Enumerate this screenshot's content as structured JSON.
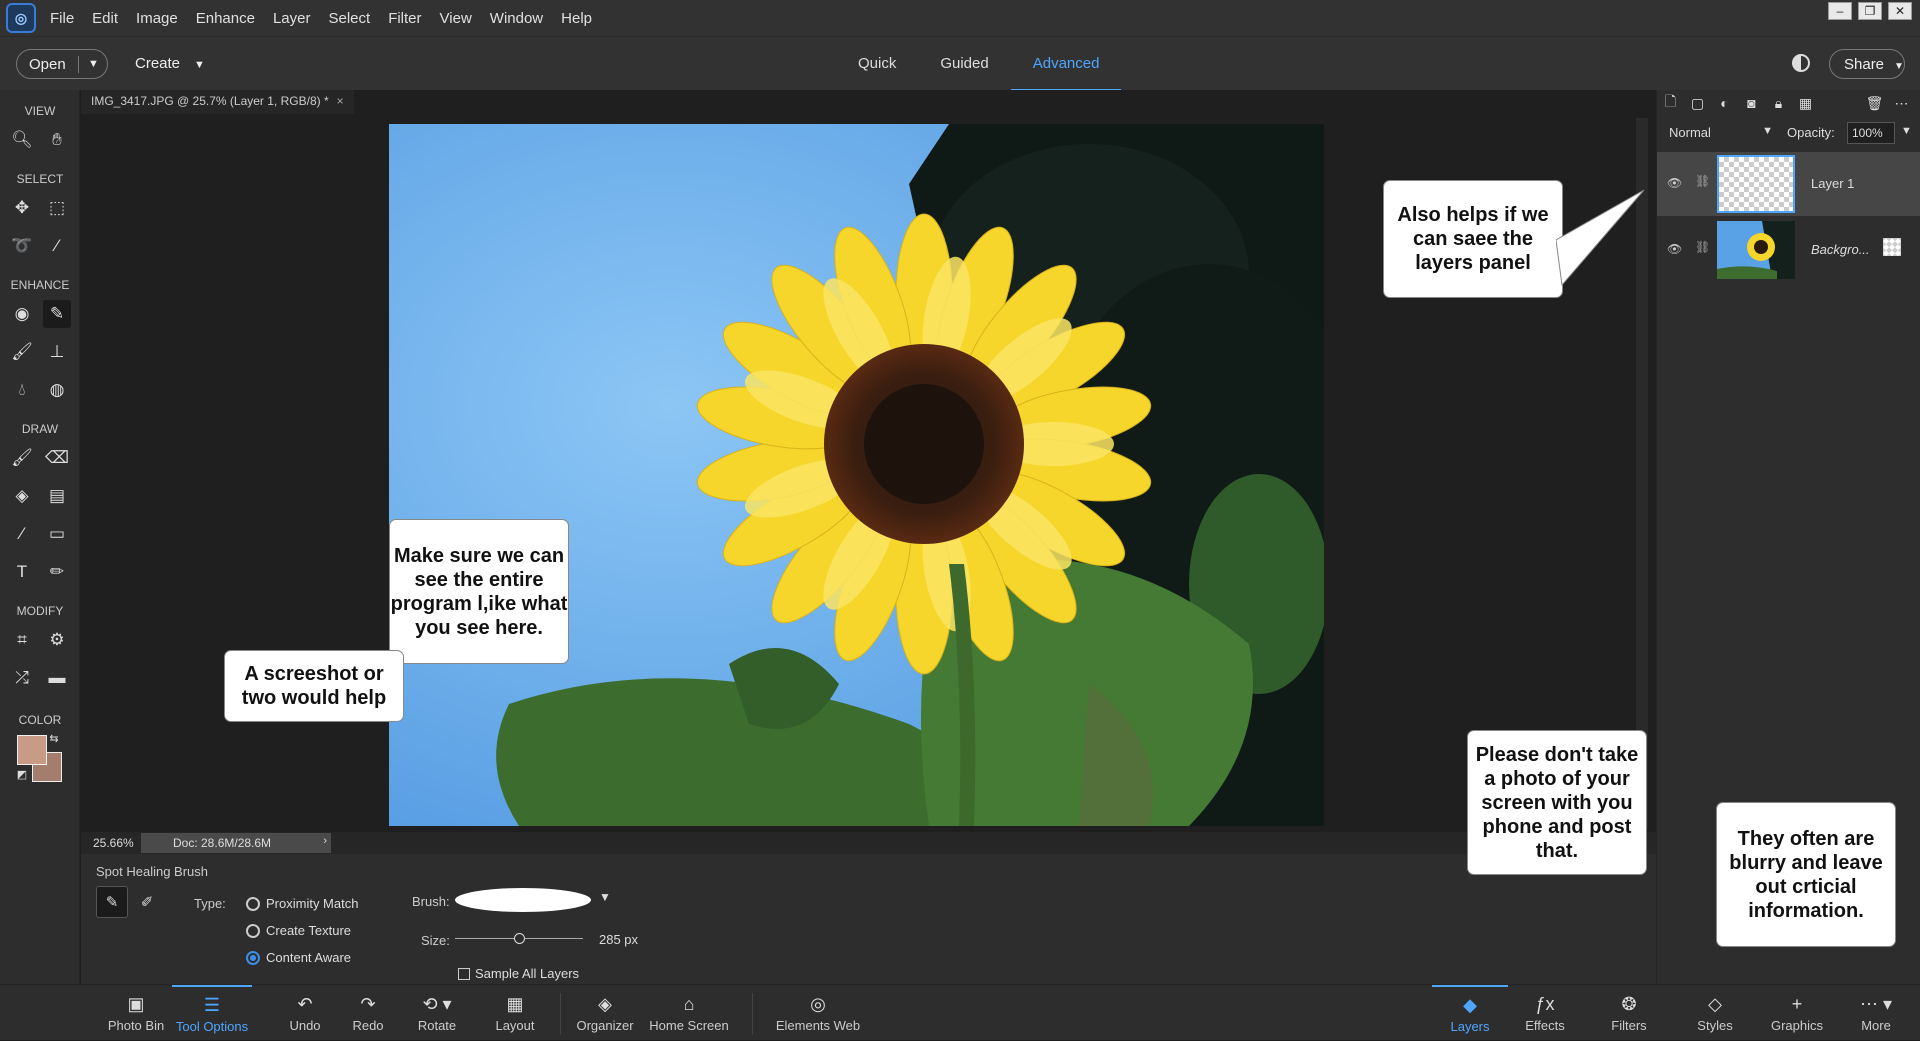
{
  "menu": [
    "File",
    "Edit",
    "Image",
    "Enhance",
    "Layer",
    "Select",
    "Filter",
    "View",
    "Window",
    "Help"
  ],
  "window_controls": [
    "–",
    "❐",
    "✕"
  ],
  "toolbar": {
    "open_label": "Open",
    "create_label": "Create",
    "modes": [
      "Quick",
      "Guided",
      "Advanced"
    ],
    "active_mode": "Advanced",
    "share_label": "Share"
  },
  "tools": {
    "sections": [
      "VIEW",
      "SELECT",
      "ENHANCE",
      "DRAW",
      "MODIFY",
      "COLOR"
    ],
    "selected_tool": "spot-healing-brush-tool",
    "foreground_color": "#c89b86",
    "background_color": "#a57d6c"
  },
  "document": {
    "tab_title": "IMG_3417.JPG @ 25.7% (Layer 1, RGB/8) *",
    "zoom": "25.66%",
    "doc_info": "Doc: 28.6M/28.6M"
  },
  "tool_options": {
    "title": "Spot Healing Brush",
    "type_label": "Type:",
    "radio_options": [
      "Proximity Match",
      "Create Texture",
      "Content Aware"
    ],
    "selected_type": "Content Aware",
    "brush_label": "Brush:",
    "size_label": "Size:",
    "size_value": "285 px",
    "size_fraction": 0.5,
    "sample_all_layers": "Sample All Layers"
  },
  "layers_panel": {
    "blend_mode": "Normal",
    "opacity_label": "Opacity:",
    "opacity_value": "100%",
    "layers": [
      {
        "name": "Layer 1",
        "selected": true
      },
      {
        "name": "Backgro...",
        "selected": false
      }
    ]
  },
  "bottom_left": [
    "Photo Bin",
    "Tool Options",
    "Undo",
    "Redo",
    "Rotate",
    "Layout",
    "Organizer",
    "Home Screen",
    "Elements Web"
  ],
  "bottom_left_active": "Tool Options",
  "bottom_right": [
    "Layers",
    "Effects",
    "Filters",
    "Styles",
    "Graphics",
    "More"
  ],
  "bottom_right_active": "Layers",
  "callouts": {
    "layers": "Also helps if we can saee the layers panel",
    "program": "Make sure we can see the entire program l,ike what you see here.",
    "screenshot": "A screeshot or two would help",
    "photo": "Please don't take a photo of your screen with you phone and post that.",
    "blurry": "They often are blurry and leave out crticial information."
  }
}
